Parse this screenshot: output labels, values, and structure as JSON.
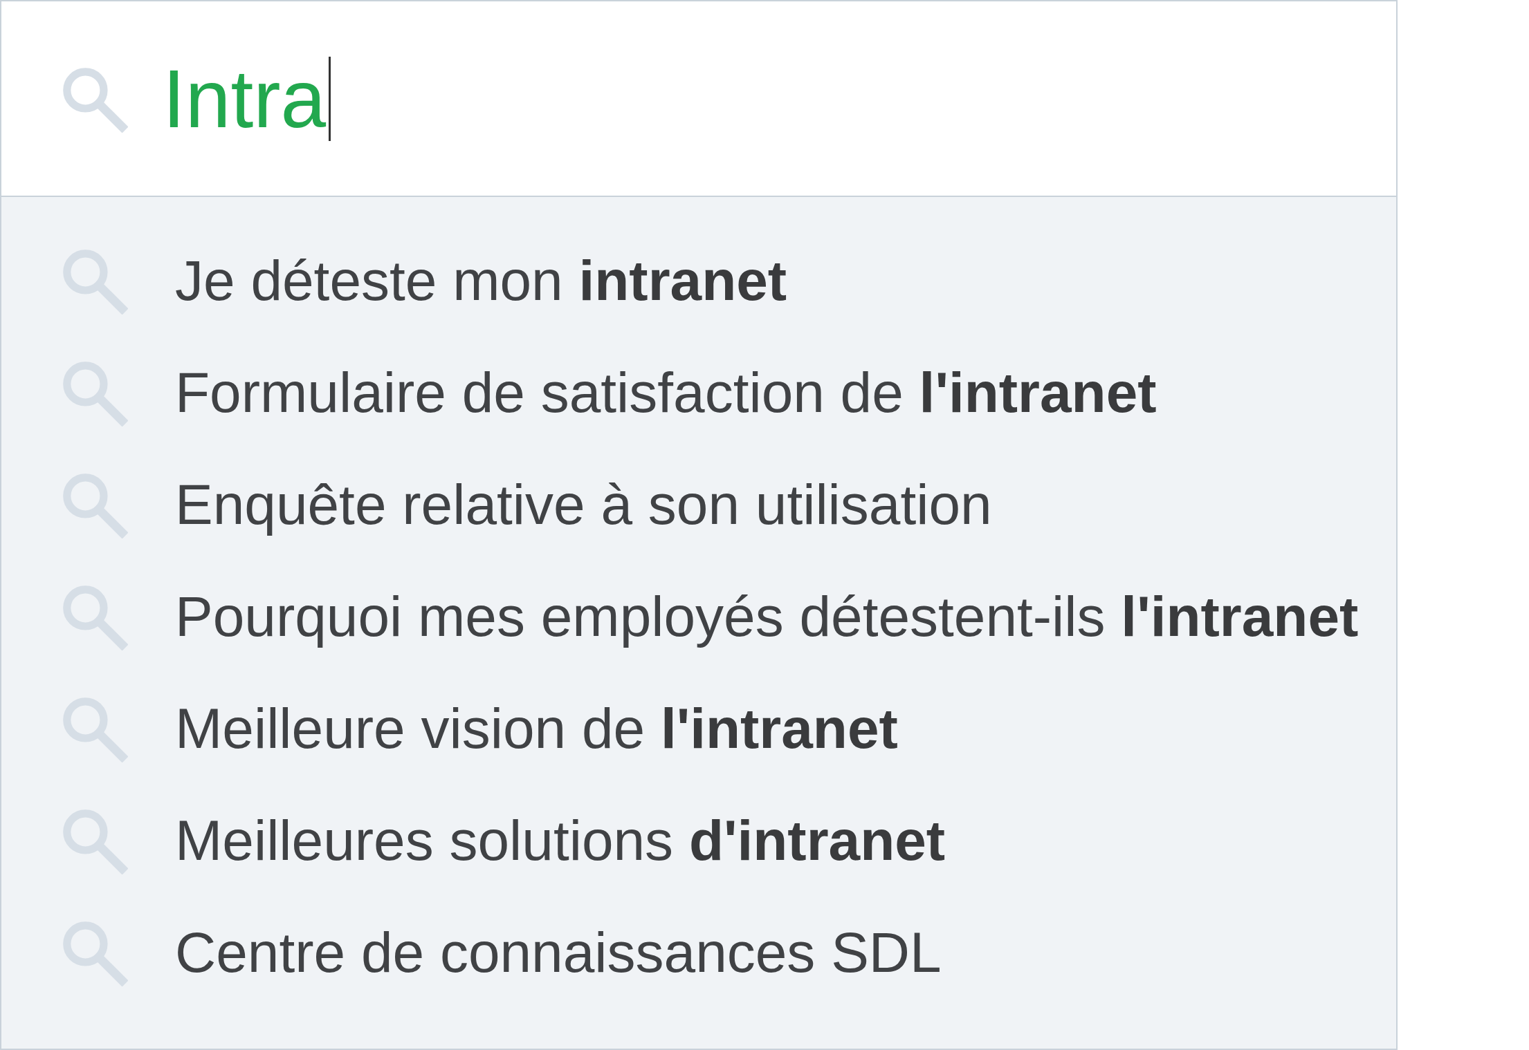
{
  "search": {
    "value": "Intra"
  },
  "suggestions": [
    {
      "text": "Je déteste mon **intranet**"
    },
    {
      "text": "Formulaire de satisfaction de **l'intranet**"
    },
    {
      "text": "Enquête relative à son utilisation"
    },
    {
      "text": "Pourquoi mes employés détestent-ils **l'intranet**"
    },
    {
      "text": "Meilleure vision de **l'intranet**"
    },
    {
      "text": "Meilleures solutions **d'intranet**"
    },
    {
      "text": "Centre de connaissances SDL"
    }
  ]
}
